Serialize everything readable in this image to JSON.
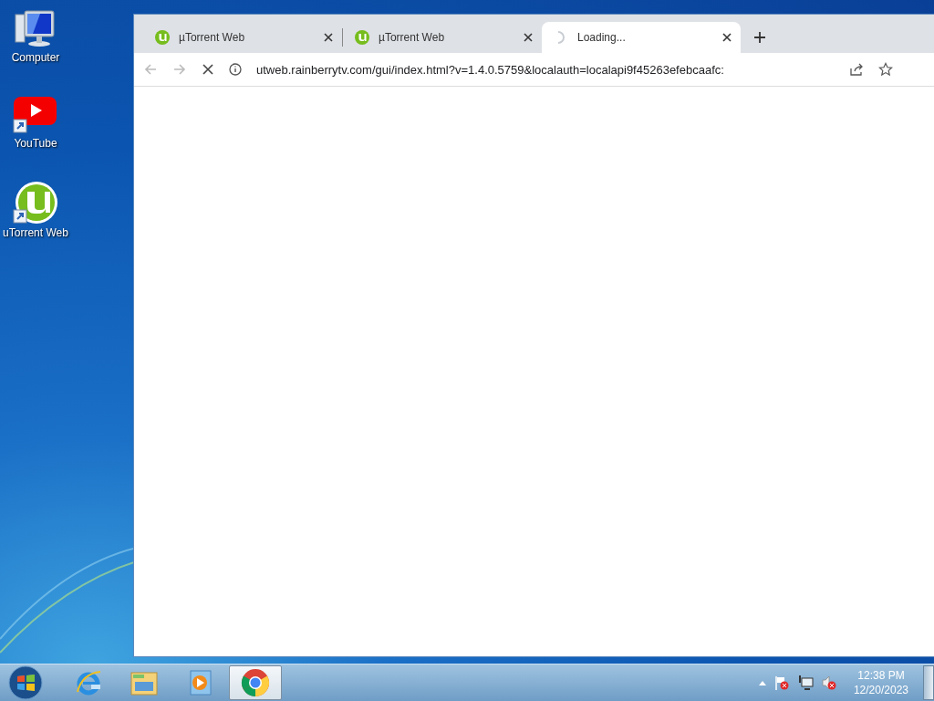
{
  "desktop_icons": [
    {
      "label": "Computer",
      "kind": "computer"
    },
    {
      "label": "YouTube",
      "kind": "youtube"
    },
    {
      "label": "uTorrent Web",
      "kind": "utorrent"
    }
  ],
  "browser": {
    "tabs": [
      {
        "title": "µTorrent Web",
        "selected": false,
        "loading": false
      },
      {
        "title": "µTorrent Web",
        "selected": false,
        "loading": false
      },
      {
        "title": "Loading...",
        "selected": true,
        "loading": true
      }
    ],
    "url": "utweb.rainberrytv.com/gui/index.html?v=1.4.0.5759&localauth=localapi9f45263efebcaafc:",
    "page_loading": true
  },
  "taskbar": {
    "apps": [
      {
        "kind": "ie",
        "selected": false
      },
      {
        "kind": "explorer",
        "selected": false
      },
      {
        "kind": "media",
        "selected": false
      },
      {
        "kind": "chrome",
        "selected": true
      }
    ],
    "time": "12:38 PM",
    "date": "12/20/2023"
  }
}
